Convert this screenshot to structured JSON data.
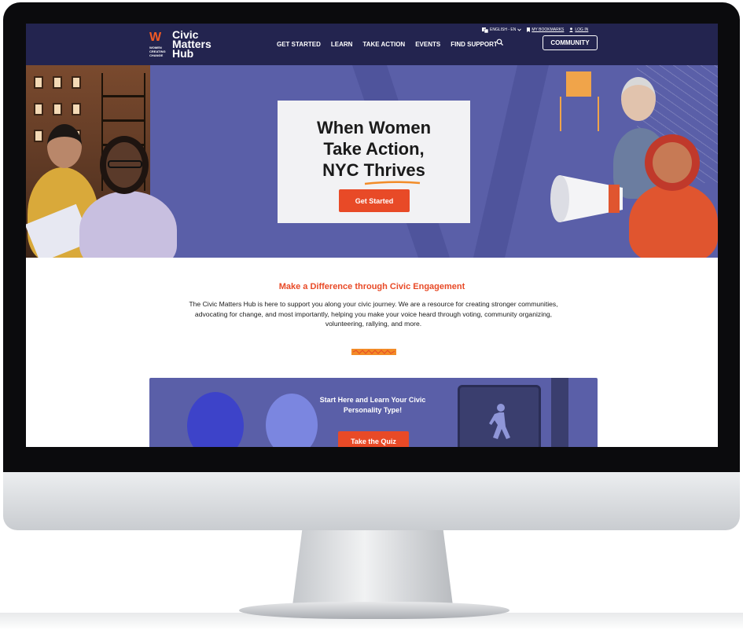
{
  "header": {
    "logo": {
      "mark": "W",
      "sub": "WOMEN CREATING CHANGE",
      "text": "Civic\nMatters\nHub"
    },
    "utility": {
      "language": "ENGLISH - EN",
      "bookmarks": "MY BOOKMARKS",
      "login": "LOG IN"
    },
    "nav": [
      "GET STARTED",
      "LEARN",
      "TAKE ACTION",
      "EVENTS",
      "FIND SUPPORT"
    ],
    "community_button": "COMMUNITY",
    "icons": [
      "translate-icon",
      "chevron-down-icon",
      "bookmark-icon",
      "user-icon",
      "search-icon"
    ]
  },
  "hero": {
    "title": "When Women\nTake Action,\nNYC Thrives",
    "button": "Get Started"
  },
  "intro": {
    "heading": "Make a Difference through Civic Engagement",
    "body": "The Civic Matters Hub is here to support you along your civic journey. We are a resource for creating stronger communities, advocating for change, and most importantly, helping you make your voice heard through voting, community organizing, volunteering, rallying, and more."
  },
  "quiz": {
    "title": "Start Here and Learn Your Civic Personality Type!",
    "button": "Take the Quiz"
  },
  "colors": {
    "navy": "#23244f",
    "hero_purple": "#5a5fa8",
    "accent_orange": "#e84a27"
  }
}
